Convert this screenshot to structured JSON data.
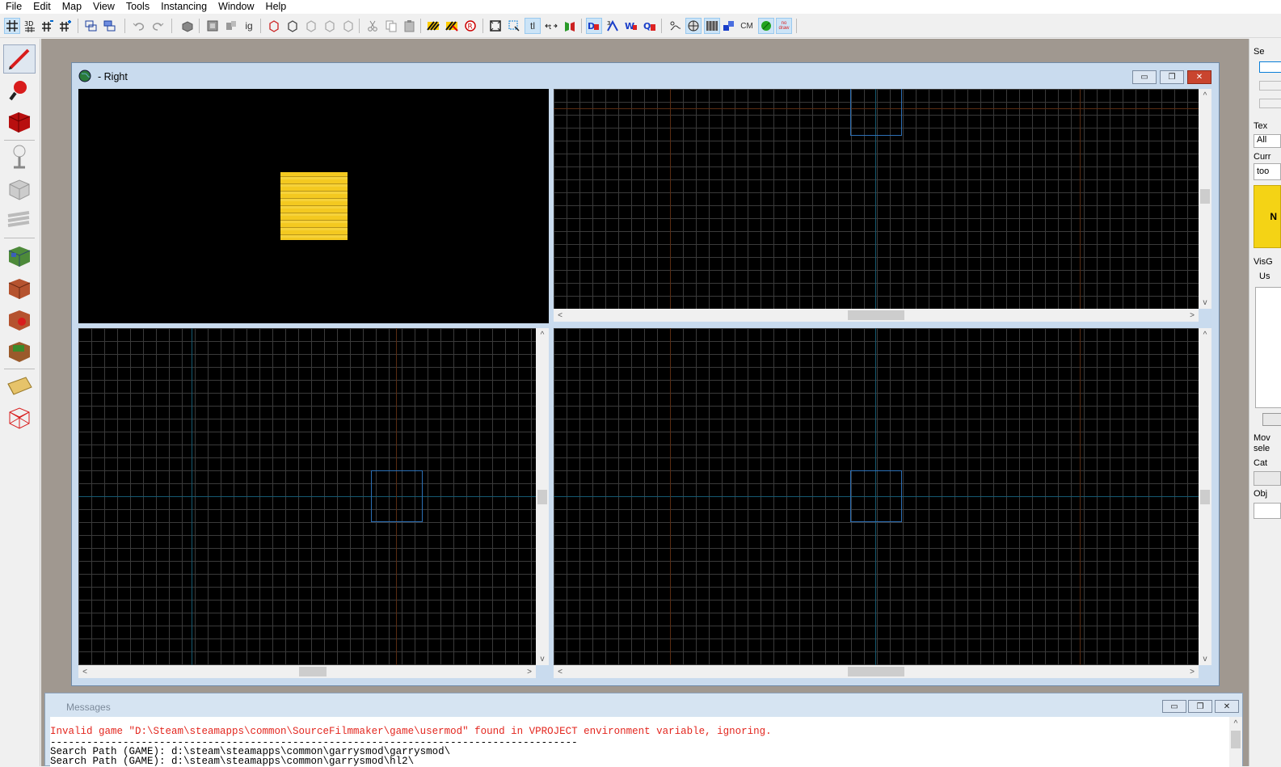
{
  "menu": [
    "File",
    "Edit",
    "Map",
    "View",
    "Tools",
    "Instancing",
    "Window",
    "Help"
  ],
  "toolbar": {
    "icons": [
      "grid-toggle-icon",
      "3d-grid-icon",
      "grid-smaller-icon",
      "grid-larger-icon",
      "group-icon",
      "ungroup-icon",
      "undo-icon",
      "redo-icon",
      "carve-icon",
      "hide-selection-icon",
      "hide-unselected-icon",
      "ignore-groups-icon",
      "cut-icon",
      "copy-icon",
      "paste-icon",
      "texture-lock-icon",
      "texture-scale-lock-icon",
      "texture-browser-icon",
      "selection-box-icon",
      "select-tool-icon",
      "text-label-icon",
      "flip-icon",
      "cm-icon"
    ],
    "ig_label": "ig",
    "tl_label": "tl",
    "cm_label": "CM",
    "nodraw_label": "no draw"
  },
  "window": {
    "title": "- Right",
    "min": "▭",
    "restore": "❐",
    "close": "✕"
  },
  "right_panel": {
    "select_label": "Se",
    "tex_label": "Tex",
    "all_option": "All",
    "cur_label": "Curr",
    "cur_value": "too",
    "vis_label": "VisG",
    "use_label": "Us",
    "move_label": "Mov",
    "sele_label": "sele",
    "cat_label": "Cat",
    "obj_label": "Obj",
    "yellow_letter": "N"
  },
  "messages": {
    "title": "Messages",
    "lines": [
      "Invalid game \"D:\\Steam\\steamapps\\common\\SourceFilmmaker\\game\\usermod\" found in VPROJECT environment variable, ignoring.",
      "---------------------------------------------------------------------------------------",
      "Search Path (GAME): d:\\steam\\steamapps\\common\\garrysmod\\garrysmod\\",
      "Search Path (GAME): d:\\steam\\steamapps\\common\\garrysmod\\hl2\\"
    ],
    "error_color": "#e3261e"
  },
  "colors": {
    "accent": "#cce4f7",
    "axis_blue": "#1d5a7a",
    "axis_red": "#6a2e15",
    "selection": "#2c6fb5"
  }
}
